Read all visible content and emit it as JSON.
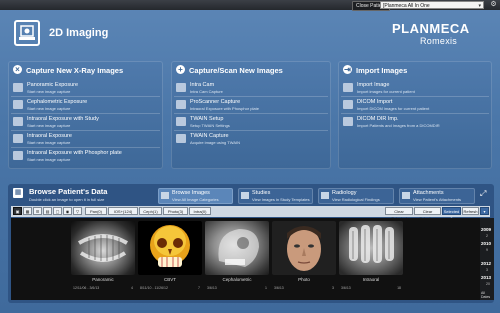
{
  "topbar": {
    "close_patient": "Close Patient",
    "patient": "[Planmeca All In One"
  },
  "header": {
    "title": "2D Imaging",
    "logo_line1": "PLANMECA",
    "logo_line2": "Romexis"
  },
  "panels": [
    {
      "title": "Capture New X-Ray Images",
      "icon": "x",
      "items": [
        {
          "title": "Panoramic Exposure",
          "subtitle": "Start new image capture"
        },
        {
          "title": "Cephalometric Exposure",
          "subtitle": "Start new image capture"
        },
        {
          "title": "Intraoral Exposure with Study",
          "subtitle": "Start new image capture"
        },
        {
          "title": "Intraoral Exposure",
          "subtitle": "Start new image capture"
        },
        {
          "title": "Intraoral Exposure with Phosphor plate",
          "subtitle": "Start new image capture"
        }
      ]
    },
    {
      "title": "Capture/Scan New Images",
      "icon": "+",
      "items": [
        {
          "title": "Intra Cam",
          "subtitle": "Intra Cam Capture"
        },
        {
          "title": "ProScanner Capture",
          "subtitle": "Intraoral Exposure with Phosphor plate"
        },
        {
          "title": "TWAIN Setup",
          "subtitle": "Setup TWAIN Settings"
        },
        {
          "title": "TWAIN Capture",
          "subtitle": "Acquire image using TWAIN"
        }
      ]
    },
    {
      "title": "Import Images",
      "icon": "⇥",
      "items": [
        {
          "title": "Import Image",
          "subtitle": "Import images for current patient"
        },
        {
          "title": "DICOM Import",
          "subtitle": "Import DICOM images for current patient"
        },
        {
          "title": "DICOM DIR Imp.",
          "subtitle": "Import Patients and Images from a DICOMDIR"
        }
      ]
    }
  ],
  "browse": {
    "title": "Browse Patient's Data",
    "subtitle": "Double click an image to open it in full size",
    "tabs": [
      {
        "title": "Browse Images",
        "subtitle": "View All Image Categories"
      },
      {
        "title": "Studies",
        "subtitle": "View Images in Study Templates"
      },
      {
        "title": "Radiology",
        "subtitle": "View Radiological Findings"
      },
      {
        "title": "Attachments",
        "subtitle": "View Patient's Attachments"
      }
    ]
  },
  "toolbar": {
    "filters": [
      "Pan(0)",
      "IOS+(124)",
      "Ceph(1)",
      "Photo(3)",
      "Intra(0)"
    ],
    "clear_selected": "Clear Selected",
    "clear_selection": "Clear Selection",
    "selected_count": "Selected 0",
    "refresh": "Refresh"
  },
  "thumbnails": [
    {
      "label": "Panoramic",
      "date": "12/11/06 - 3/6/13",
      "count": "4"
    },
    {
      "label": "CBVT",
      "date": "8/11/10 - 11/26/12",
      "count": "7"
    },
    {
      "label": "Cephalometric",
      "date": "3/6/13",
      "count": "1"
    },
    {
      "label": "Photo",
      "date": "3/6/13",
      "count": "3"
    },
    {
      "label": "Intraoral",
      "date": "3/6/13",
      "count": "18"
    }
  ],
  "years": [
    {
      "year": "2009",
      "count": "2"
    },
    {
      "year": "2010",
      "count": "9"
    },
    {
      "year": "2012",
      "count": "3"
    },
    {
      "year": "2013",
      "count": "20"
    }
  ],
  "all_dates": "All Dates"
}
